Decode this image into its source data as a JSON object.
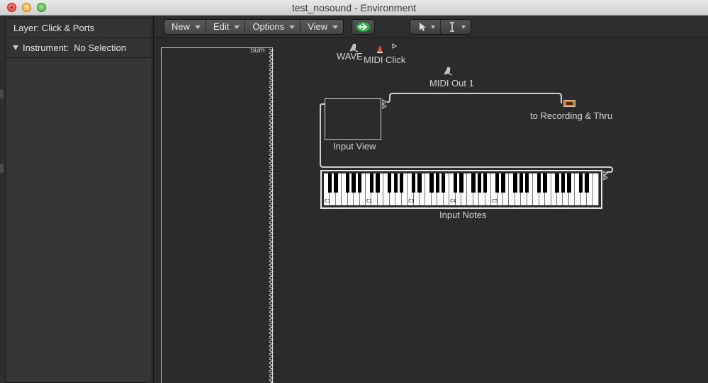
{
  "window": {
    "title": "test_nosound - Environment"
  },
  "inspector": {
    "layer_label": "Layer: Click & Ports",
    "instrument_label": "Instrument:",
    "instrument_value": "No Selection"
  },
  "toolbar": {
    "menus": [
      {
        "label": "New"
      },
      {
        "label": "Edit"
      },
      {
        "label": "Options"
      },
      {
        "label": "View"
      }
    ],
    "link_icon": "link-arrow-icon",
    "tools": [
      {
        "icon": "pointer-icon"
      },
      {
        "icon": "text-cursor-icon"
      }
    ],
    "accent_green": "#2fae4a"
  },
  "environment": {
    "mixer": {
      "sum_label": "Sum"
    },
    "objects": {
      "wave": "WAVE",
      "midi_click": "MIDI Click",
      "midi_out": "MIDI Out 1",
      "input_view": "Input View",
      "recording": "to Recording & Thru",
      "input_notes": "Input Notes"
    },
    "keyboard": {
      "octave_labels": [
        "C1",
        "C2",
        "C3",
        "C4",
        "C5"
      ]
    }
  }
}
